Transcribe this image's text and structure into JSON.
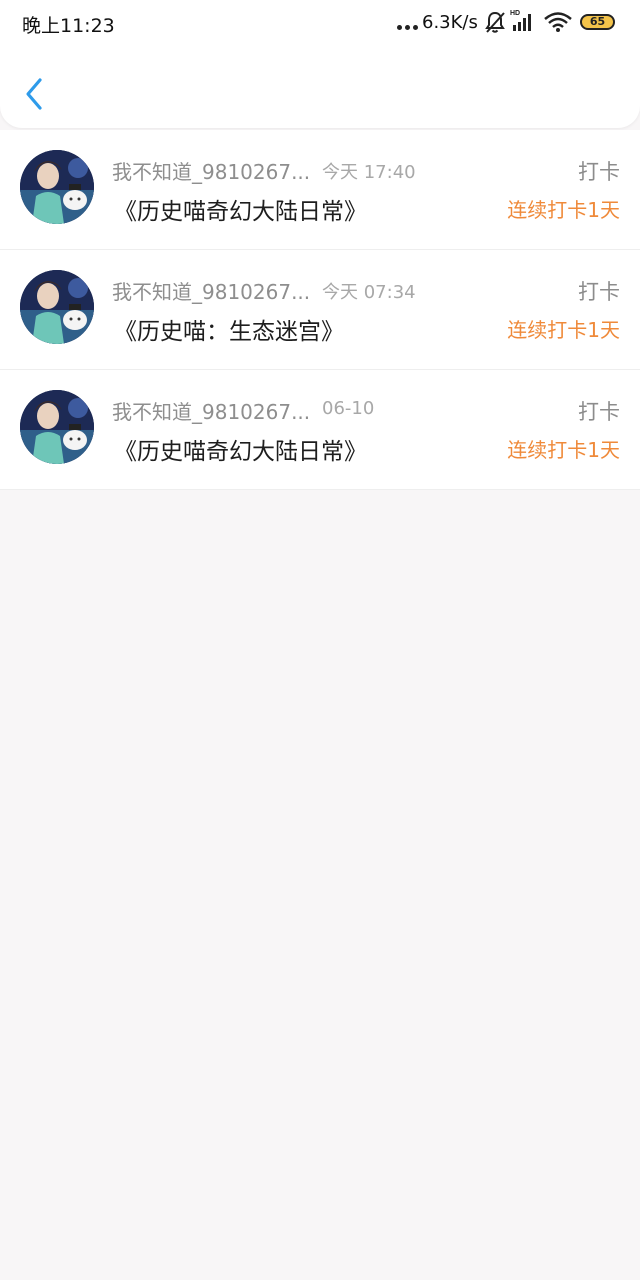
{
  "status_bar": {
    "time": "晚上11:23",
    "network_speed": "6.3K/s",
    "hd_label": "HD",
    "battery": "65",
    "icons": [
      "dots-icon",
      "bell-muted-icon",
      "signal-icon",
      "wifi-icon",
      "battery-icon"
    ]
  },
  "header": {
    "back_icon": "chevron-left-icon",
    "accent_color": "#2e9bea"
  },
  "feed": {
    "items": [
      {
        "user": "我不知道_9810267...",
        "time": "今天 17:40",
        "book": "《历史喵奇幻大陆日常》",
        "action": "打卡",
        "streak": "连续打卡1天"
      },
      {
        "user": "我不知道_9810267...",
        "time": "今天 07:34",
        "book": "《历史喵：生态迷宫》",
        "action": "打卡",
        "streak": "连续打卡1天"
      },
      {
        "user": "我不知道_9810267...",
        "time": "06-10",
        "book": "《历史喵奇幻大陆日常》",
        "action": "打卡",
        "streak": "连续打卡1天"
      }
    ]
  },
  "colors": {
    "streak": "#ef8a3a",
    "background": "#f8f6f7"
  }
}
